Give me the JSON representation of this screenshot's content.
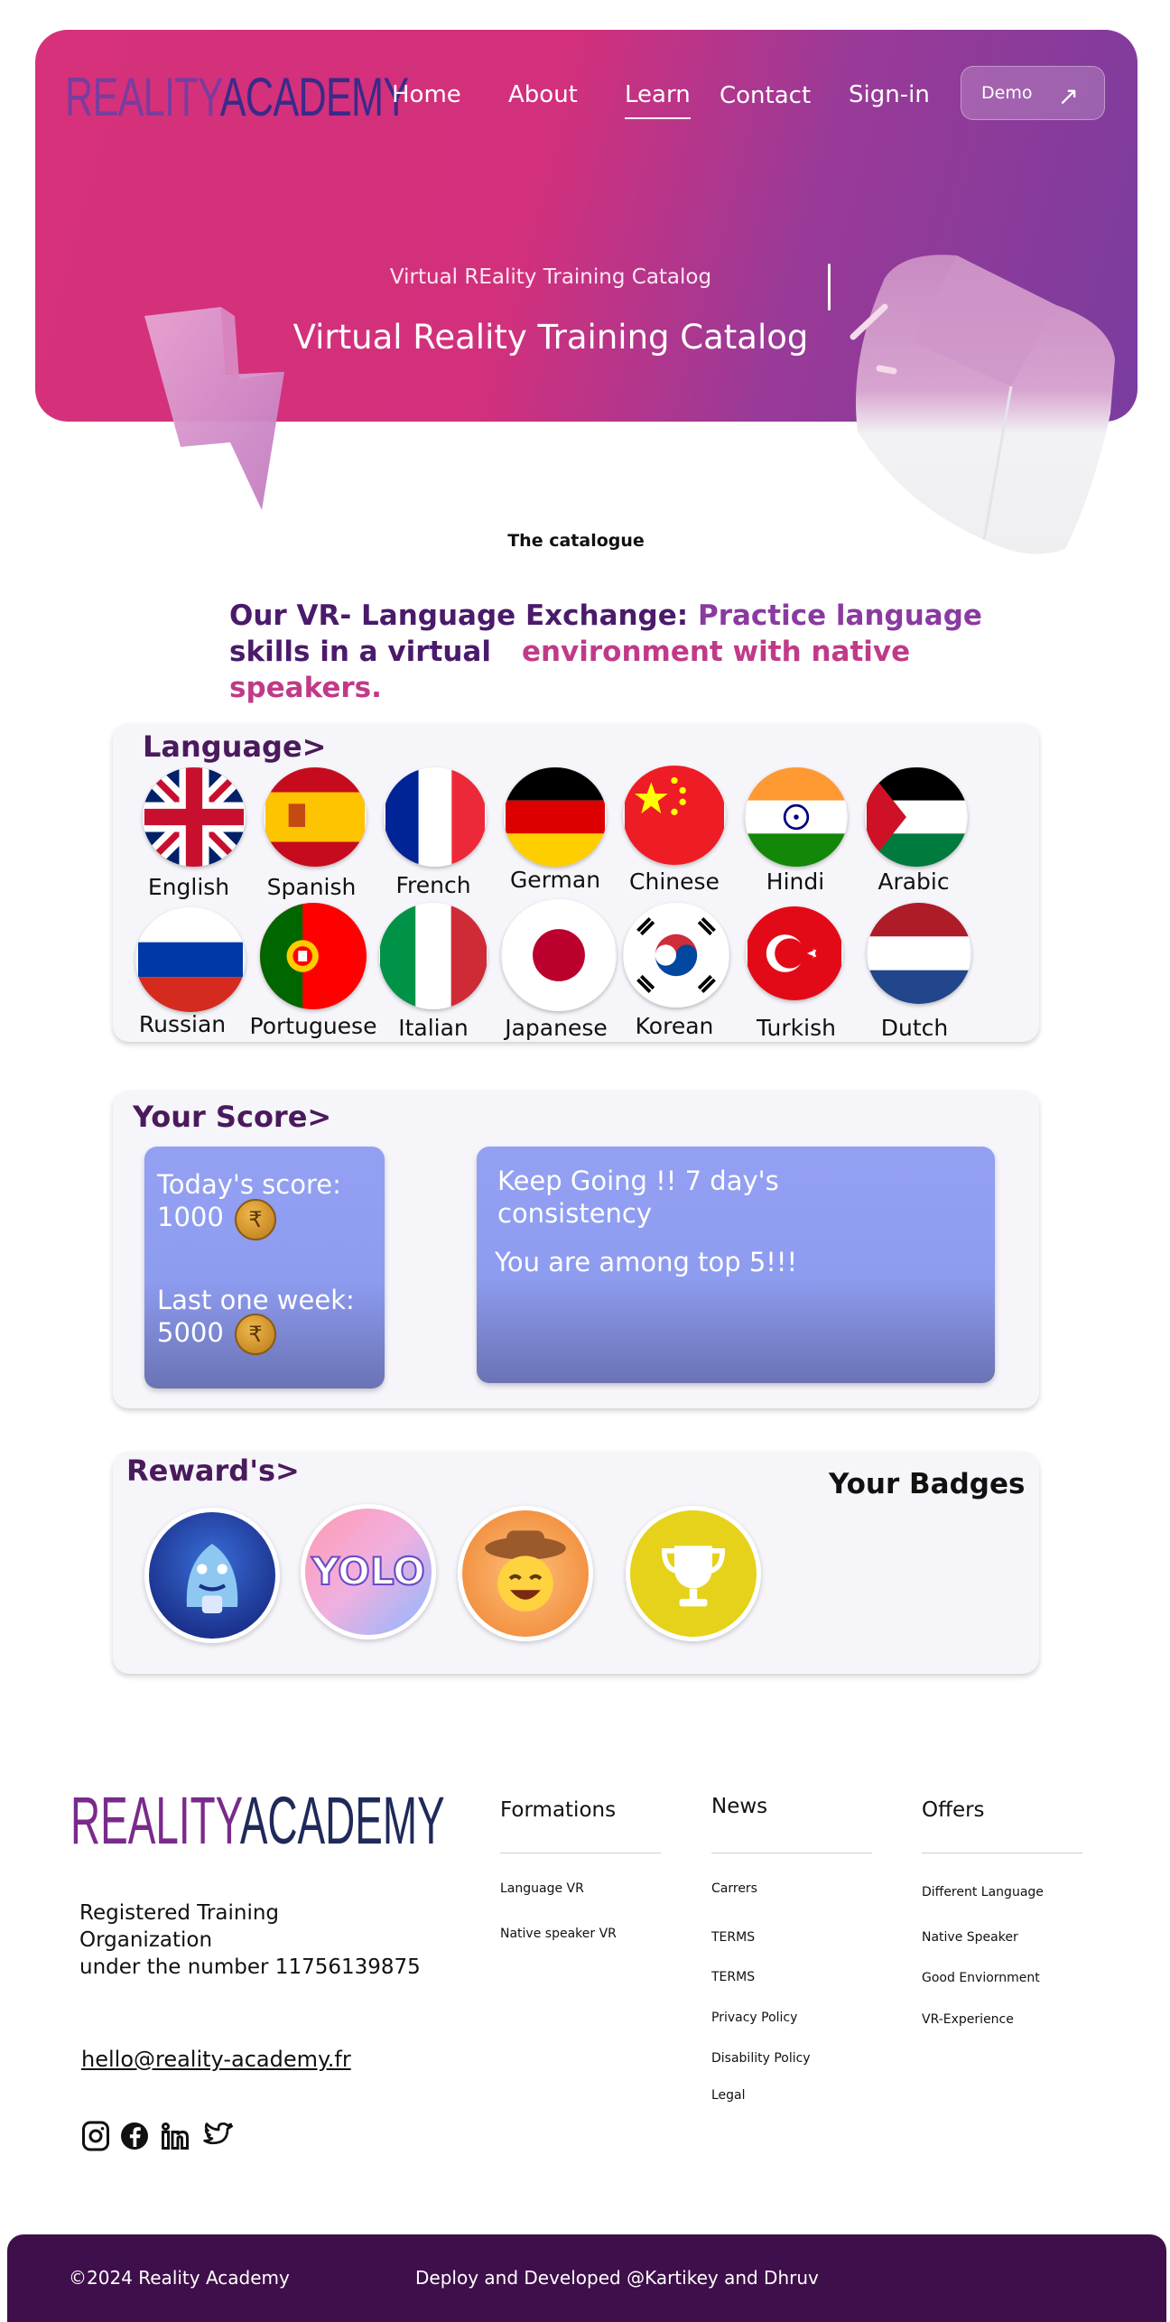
{
  "header": {
    "logo_part1": "REALITY",
    "logo_part2": "ACADEMY",
    "nav": [
      "Home",
      "About",
      "Learn",
      "Contact",
      "Sign-in"
    ],
    "active_nav": "Learn",
    "demo_label": "Demo",
    "subtitle": "Virtual REality Training Catalog",
    "title": "Virtual Reality Training Catalog"
  },
  "catalogue": {
    "label": "The catalogue",
    "headline_part1": "Our VR- Language Exchange: ",
    "headline_part2": "Practice language",
    "headline_part3": "skills in a virtual",
    "headline_part4": "environment with native speakers."
  },
  "language": {
    "title": "Language>",
    "row1": [
      "English",
      "Spanish",
      "French",
      "German",
      "Chinese",
      "Hindi",
      "Arabic"
    ],
    "row2": [
      "Russian",
      "Portuguese",
      "Italian",
      "Japanese",
      "Korean",
      "Turkish",
      "Dutch"
    ]
  },
  "score": {
    "title": "Your Score>",
    "today_label": "Today's score:",
    "today_value": "1000",
    "week_label": "Last one week:",
    "week_value": "5000",
    "coin_symbol": "₹",
    "message1": "Keep Going !! 7 day's consistency",
    "message2": "You are among top 5!!!"
  },
  "rewards": {
    "title": "Reward's>",
    "badges_title": "Your Badges",
    "items": [
      "shark-badge",
      "yolo-badge",
      "cowboy-badge",
      "trophy-badge"
    ]
  },
  "footer": {
    "logo_part1": "REALITY",
    "logo_part2": "ACADEMY",
    "reg_line1": "Registered Training",
    "reg_line2": "Organization",
    "reg_line3": "under the number 11756139875",
    "email": "hello@reality-academy.fr",
    "columns": [
      {
        "title": "Formations",
        "links": [
          "Language VR",
          "Native speaker VR"
        ]
      },
      {
        "title": "News",
        "links": [
          "Carrers",
          "TERMS",
          "TERMS",
          "Privacy Policy",
          "Disability Policy",
          "Legal"
        ]
      },
      {
        "title": "Offers",
        "links": [
          "Different Language",
          "Native Speaker",
          "Good Enviornment",
          "VR-Experience"
        ]
      }
    ],
    "copyright": "©2024 Reality Academy",
    "credits": "Deploy and Developed @Kartikey and Dhruv"
  },
  "colors": {
    "brand_pink": "#d6317a",
    "brand_purple": "#7a3c9e",
    "dark_purple": "#3e0f4a",
    "score_blue": "#93a0f2"
  }
}
